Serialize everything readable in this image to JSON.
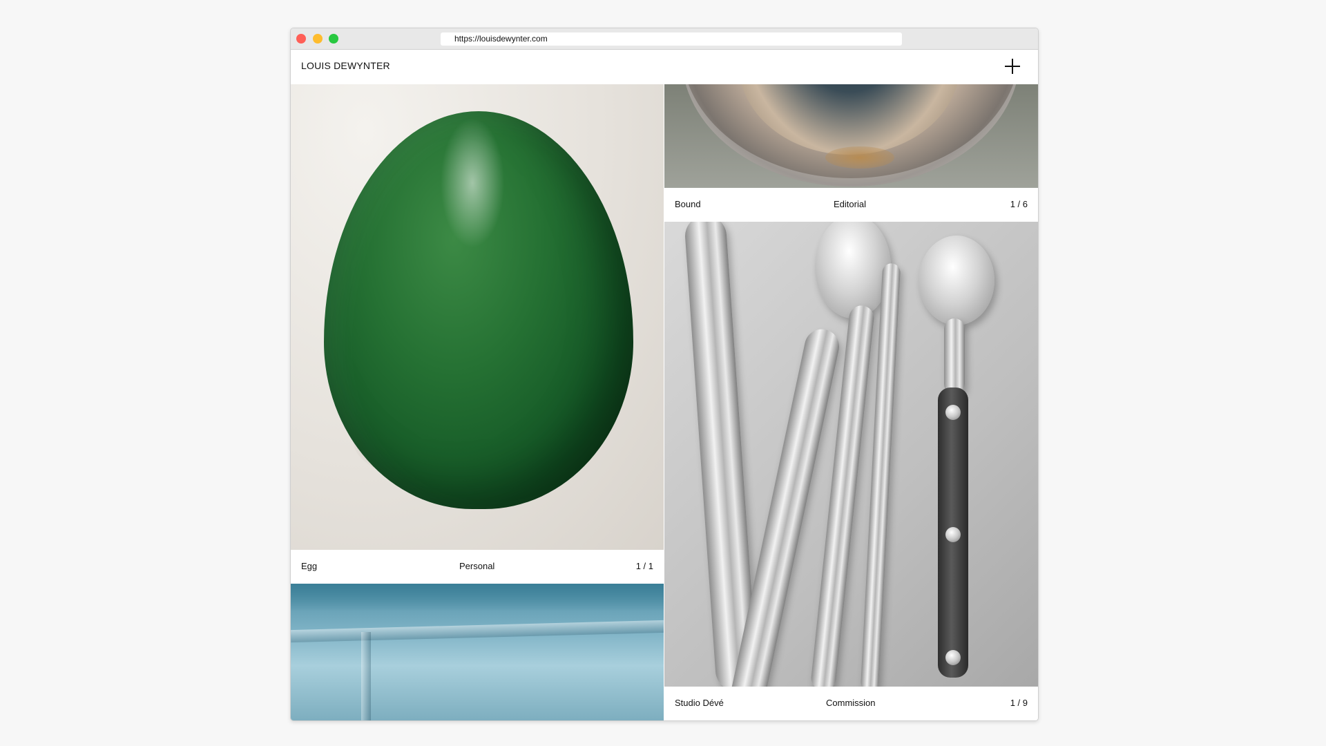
{
  "browser": {
    "url": "https://louisdewynter.com"
  },
  "header": {
    "brand": "LOUIS DEWYNTER",
    "menu_icon": "plus-icon"
  },
  "projects": [
    {
      "title": "Egg",
      "category": "Personal",
      "counter": "1 / 1"
    },
    {
      "title": "Bound",
      "category": "Editorial",
      "counter": "1 / 6"
    },
    {
      "title": "Studio Dévé",
      "category": "Commission",
      "counter": "1 / 9"
    }
  ],
  "colors": {
    "egg_green": "#1f6b2e",
    "window_red": "#ff5f57",
    "window_yellow": "#febc2e",
    "window_green": "#28c840"
  }
}
